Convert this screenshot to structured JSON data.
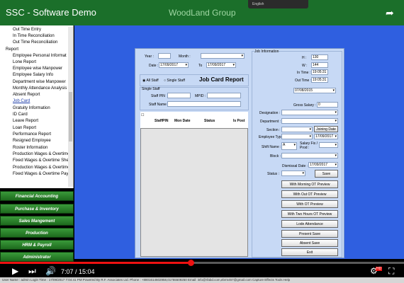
{
  "header": {
    "app_title": "SSC - Software Demo",
    "company": "WoodLand Group",
    "lang": "English"
  },
  "sidebar": {
    "items": [
      "Out Time Entry",
      "In Time Reconciliation",
      "Out Time Reconciliation",
      "Report",
      "Employee Personal Informat",
      "Lone Report",
      "Employee wise Manpower",
      "Employee Salary Info",
      "Department wise Manpower",
      "Monthly Attendance Analysis",
      "Absent Report",
      "Job Card",
      "Gratuity Information",
      "ID Card",
      "Leave Report",
      "Loan Report",
      "Performance Report",
      "Resigned Employee",
      "Roster Information",
      "Production Wages & Overtime",
      "Fixed Wages & Overtime She",
      "Production Wages & Overtime",
      "Fixed Wages & Overtime Pay"
    ],
    "modules": [
      "Financial Accounting",
      "Purchase & Inventory",
      "Sales Mangement",
      "Production",
      "HRM & Payroll",
      "Administrator"
    ]
  },
  "form": {
    "year_label": "Year :",
    "month_label": "Month :",
    "date_label": "Date :",
    "date_from": "17/09/2017",
    "to_label": "To",
    "date_to": "17/09/2017",
    "all_staff": "All Staff",
    "single_staff": "Single Staff",
    "report_title": "Job Card Report",
    "single_staff_group": "Single Staff",
    "staff_pin_label": "Staff PIN",
    "mpid_label": "MPID :",
    "staff_name_label": "Staff Name",
    "grid_headers": [
      "StaffPIN",
      "Mon Date",
      "Status",
      "Is Post"
    ]
  },
  "job_info": {
    "title": "Job Information",
    "h_label": "H :",
    "h_value": "130",
    "w_label": "W :",
    "w_value": "144",
    "intime_label": "In Time :",
    "intime_value": "19:05:31",
    "outtime_label": "Out Time :",
    "outtime_value": "19:05:31",
    "date_value": "07/08/2015",
    "gross_label": "Gross Salary :",
    "gross_value": "0",
    "designation_label": "Designation :",
    "department_label": "Department :",
    "section_label": "Section :",
    "joining_date_label": "Joining Date",
    "emp_type_label": "Employee Type :",
    "emp_type_date": "17/09/2017",
    "shift_label": "Shift Name :",
    "shift_value": "A",
    "salary_label": "Salary Fix / Prod :",
    "block_label": "Block :",
    "dismissal_label": "Dismissal Date :",
    "dismissal_value": "17/09/2017",
    "status_label": "Status :",
    "save_label": "Save",
    "buttons": [
      "With Morning OT Preview",
      "With Out OT Preview",
      "With OT Preview",
      "With Two Hours OT Preview",
      "Lode Attendance",
      "Present Save",
      "Absent Save",
      "Exit"
    ]
  },
  "video": {
    "time": "7:07 / 15:04",
    "progress": 0.47,
    "hd": "HD"
  },
  "statusbar": {
    "text": "User Name : admin  Login Time : 17/09/2017 7:04:41 PM  Powered By R.F. Associates Ltd.  Phone : +8801614602958,01755509250  Email: info@rfabd.com,ebrm457@gmail.com  Capture  Effects  Tools  Help"
  }
}
